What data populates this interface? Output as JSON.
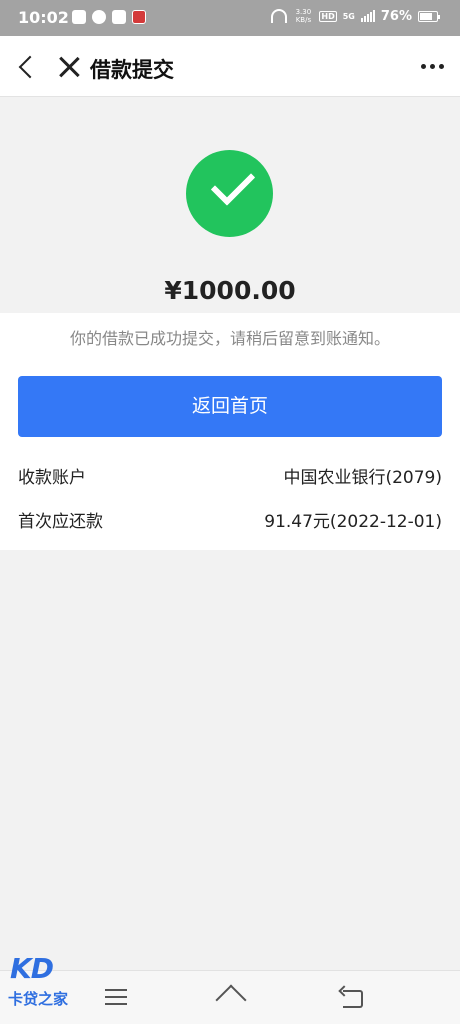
{
  "status_bar": {
    "time": "10:02",
    "speed": "3.30\nKB/s",
    "hd": "HD",
    "network": "5G",
    "battery": "76%",
    "battery_level": 0.76
  },
  "header": {
    "title": "借款提交"
  },
  "result": {
    "amount": "¥1000.00",
    "notice": "你的借款已成功提交，请稍后留意到账通知。",
    "status_color": "#22c45d"
  },
  "actions": {
    "home_label": "返回首页",
    "accent_color": "#3478f6"
  },
  "details": [
    {
      "label": "收款账户",
      "value": "中国农业银行(2079)"
    },
    {
      "label": "首次应还款",
      "value": "91.47元(2022-12-01)"
    }
  ],
  "watermark": {
    "logo": "KD",
    "name": "卡贷之家"
  }
}
